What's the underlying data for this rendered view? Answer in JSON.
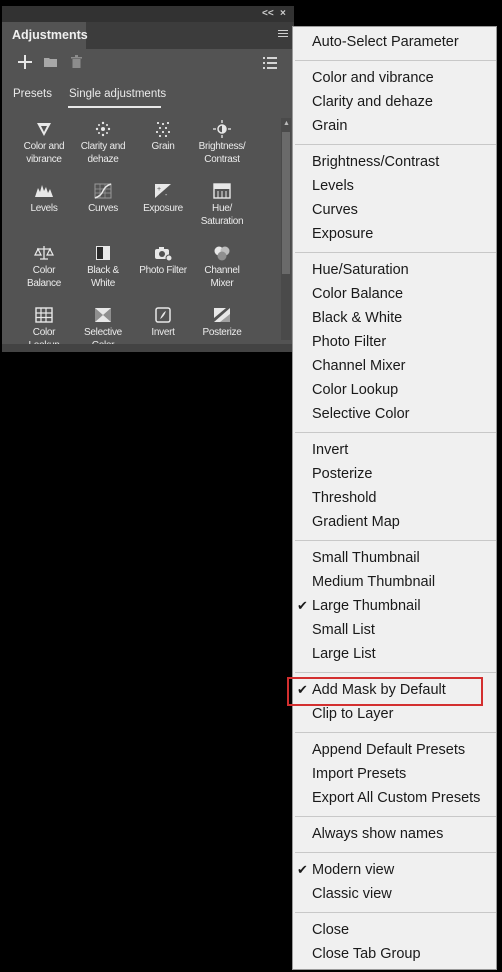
{
  "panel": {
    "title": "Adjustments",
    "collapse_glyph": "<<",
    "close_glyph": "×",
    "toolbar_icons": [
      "add-icon",
      "folder-icon",
      "trash-icon",
      "list-view-icon"
    ],
    "subtabs": [
      {
        "label": "Presets",
        "active": false
      },
      {
        "label": "Single adjustments",
        "active": true
      }
    ],
    "grid": [
      {
        "label": "Color and\nvibrance",
        "icon": "triangle-icon"
      },
      {
        "label": "Clarity and\ndehaze",
        "icon": "sparkle-icon"
      },
      {
        "label": "Grain",
        "icon": "grain-icon"
      },
      {
        "label": "Brightness/\nContrast",
        "icon": "sun-icon"
      },
      {
        "label": "Levels",
        "icon": "levels-icon"
      },
      {
        "label": "Curves",
        "icon": "curves-icon"
      },
      {
        "label": "Exposure",
        "icon": "exposure-icon"
      },
      {
        "label": "Hue/\nSaturation",
        "icon": "hue-saturation-icon"
      },
      {
        "label": "Color\nBalance",
        "icon": "scale-icon"
      },
      {
        "label": "Black &\nWhite",
        "icon": "black-white-icon"
      },
      {
        "label": "Photo Filter",
        "icon": "camera-icon"
      },
      {
        "label": "Channel\nMixer",
        "icon": "channel-mixer-icon"
      },
      {
        "label": "Color\nLookup",
        "icon": "grid-icon"
      },
      {
        "label": "Selective\nColor",
        "icon": "selective-color-icon"
      },
      {
        "label": "Invert",
        "icon": "invert-icon"
      },
      {
        "label": "Posterize",
        "icon": "posterize-icon"
      }
    ]
  },
  "menu": {
    "groups": [
      [
        {
          "label": "Auto-Select Parameter",
          "checked": false
        }
      ],
      [
        {
          "label": "Color and vibrance",
          "checked": false
        },
        {
          "label": "Clarity and dehaze",
          "checked": false
        },
        {
          "label": "Grain",
          "checked": false
        }
      ],
      [
        {
          "label": "Brightness/Contrast",
          "checked": false
        },
        {
          "label": "Levels",
          "checked": false
        },
        {
          "label": "Curves",
          "checked": false
        },
        {
          "label": "Exposure",
          "checked": false
        }
      ],
      [
        {
          "label": "Hue/Saturation",
          "checked": false
        },
        {
          "label": "Color Balance",
          "checked": false
        },
        {
          "label": "Black & White",
          "checked": false
        },
        {
          "label": "Photo Filter",
          "checked": false
        },
        {
          "label": "Channel Mixer",
          "checked": false
        },
        {
          "label": "Color Lookup",
          "checked": false
        },
        {
          "label": "Selective Color",
          "checked": false
        }
      ],
      [
        {
          "label": "Invert",
          "checked": false
        },
        {
          "label": "Posterize",
          "checked": false
        },
        {
          "label": "Threshold",
          "checked": false
        },
        {
          "label": "Gradient Map",
          "checked": false
        }
      ],
      [
        {
          "label": "Small Thumbnail",
          "checked": false
        },
        {
          "label": "Medium Thumbnail",
          "checked": false
        },
        {
          "label": "Large Thumbnail",
          "checked": true
        },
        {
          "label": "Small List",
          "checked": false
        },
        {
          "label": "Large List",
          "checked": false
        }
      ],
      [
        {
          "label": "Add Mask by Default",
          "checked": true,
          "highlighted": true
        },
        {
          "label": "Clip to Layer",
          "checked": false
        }
      ],
      [
        {
          "label": "Append Default Presets",
          "checked": false
        },
        {
          "label": "Import Presets",
          "checked": false
        },
        {
          "label": "Export All Custom Presets",
          "checked": false
        }
      ],
      [
        {
          "label": "Always show names",
          "checked": false
        }
      ],
      [
        {
          "label": "Modern view",
          "checked": true
        },
        {
          "label": "Classic view",
          "checked": false
        }
      ],
      [
        {
          "label": "Close",
          "checked": false
        },
        {
          "label": "Close Tab Group",
          "checked": false
        }
      ]
    ],
    "check_glyph": "✔",
    "highlight_color": "#d32f2f"
  }
}
